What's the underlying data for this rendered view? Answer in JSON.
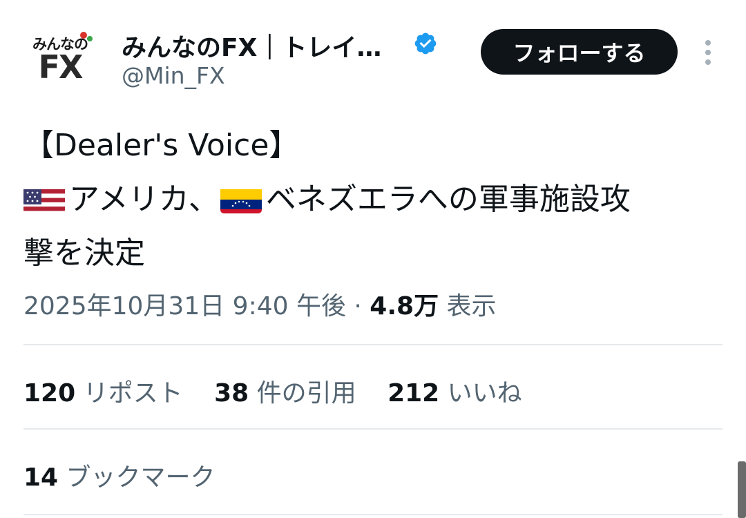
{
  "header": {
    "avatar_text_top": "みんなの",
    "avatar_text_fx": "FX",
    "display_name": "みんなのFX｜トレイ…",
    "handle": "@Min_FX",
    "verified_icon": "verified-badge-icon",
    "follow_label": "フォローする",
    "more_icon": "more-vertical-icon"
  },
  "tweet": {
    "line1": "【Dealer's Voice】",
    "line2_part1": "アメリカ、",
    "line2_part2": "ベネズエラへの軍事施設攻",
    "line3": "撃を決定",
    "flag_us": "us-flag-icon",
    "flag_ve": "venezuela-flag-icon"
  },
  "meta": {
    "timestamp": "2025年10月31日 9:40 午後 · ",
    "views_count": "4.8万",
    "views_label": " 表示"
  },
  "stats": {
    "reposts": {
      "num": "120",
      "label": " リポスト"
    },
    "quotes": {
      "num": "38",
      "label": " 件の引用"
    },
    "likes": {
      "num": "212",
      "label": " いいね"
    }
  },
  "bookmarks": {
    "num": "14",
    "label": " ブックマーク"
  },
  "colors": {
    "text_primary": "#0f1419",
    "text_secondary": "#536471",
    "verified_blue": "#1d9bf0",
    "follow_bg": "#0f1419",
    "divider": "#e6e9ec"
  }
}
